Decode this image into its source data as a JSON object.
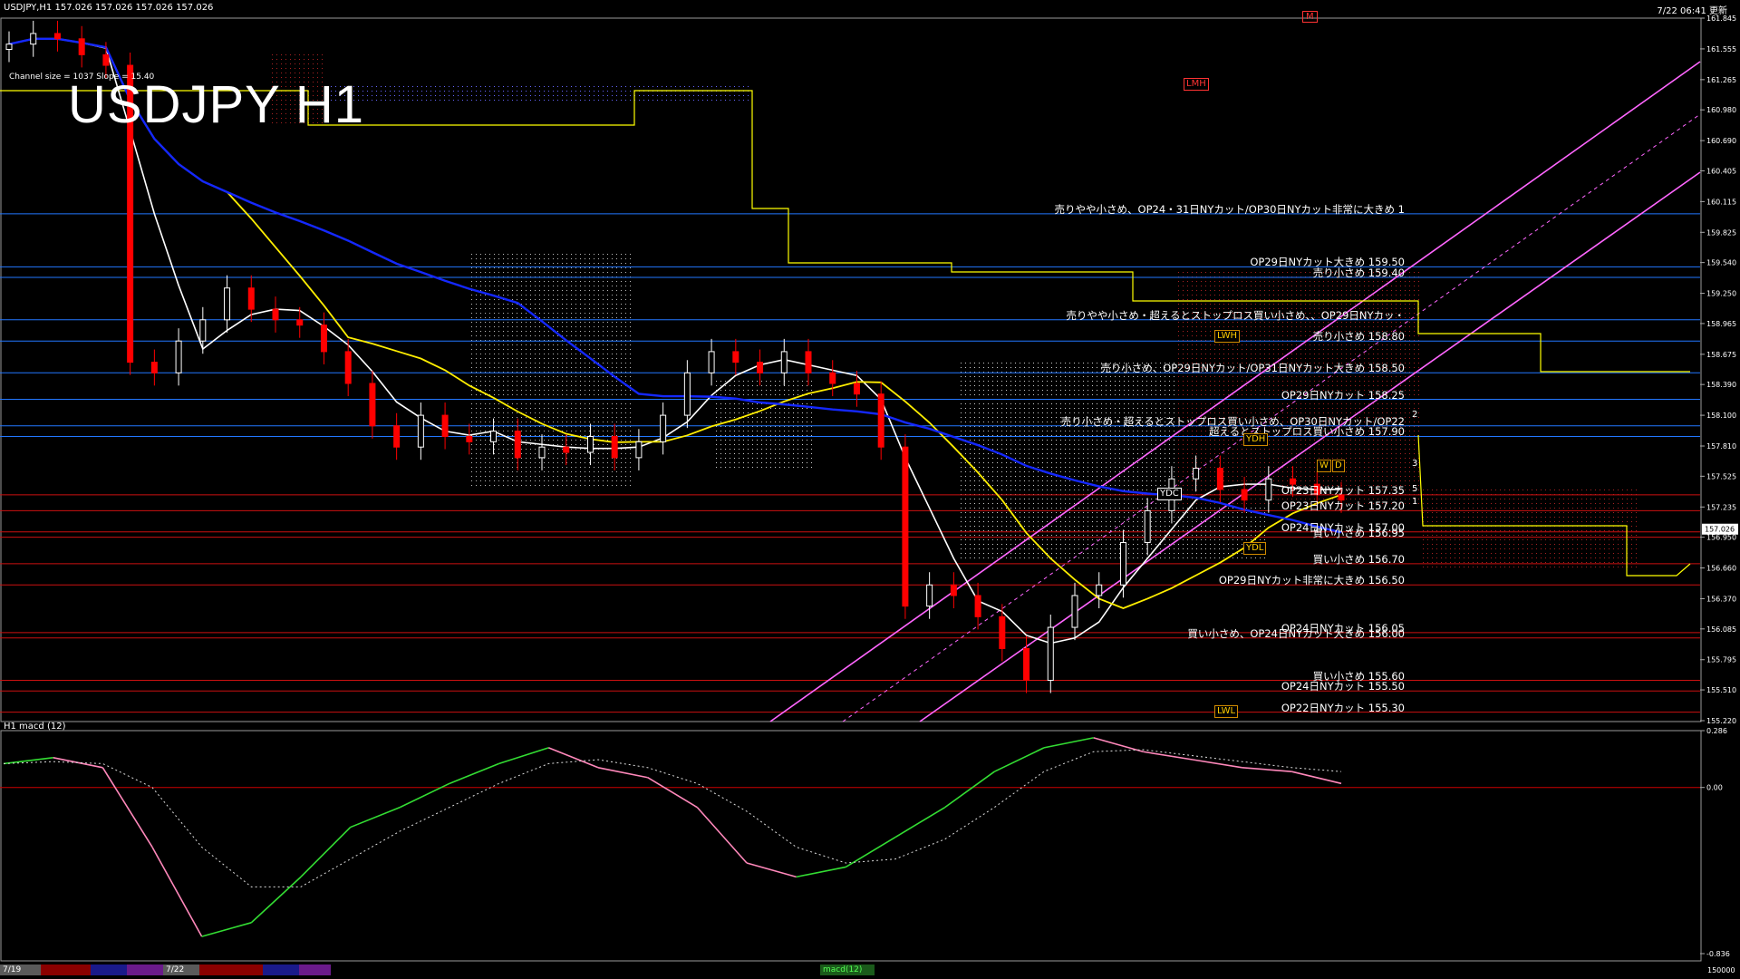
{
  "header": {
    "symbol_info": "USDJPY,H1  157.026 157.026 157.026 157.026",
    "datetime": "7/22 06:41 更新",
    "title": "USDJPY H1",
    "channel_info": "Channel size = 1037 Slope = 15.40",
    "m_marker": "M"
  },
  "colors": {
    "background": "#000000",
    "up_candle": "#ffffff",
    "down_candle": "#ff0000",
    "ma_white": "#ffffff",
    "ma_yellow": "#ffee00",
    "ma_blue": "#1428ff",
    "ichimoku_span": "#ffff00",
    "channel": "#ff66ff",
    "level_blue": "#2277ff",
    "level_red": "#cc1111",
    "macd_main_up": "#33dd33",
    "macd_main_down": "#ff88bb"
  },
  "chart_data": [
    {
      "type": "candlestick",
      "title": "USDJPY H1",
      "ylim": [
        155.22,
        161.845
      ],
      "y_ticks": [
        "161.845",
        "161.555",
        "161.265",
        "160.980",
        "160.690",
        "160.405",
        "160.115",
        "159.825",
        "159.540",
        "159.250",
        "158.965",
        "158.675",
        "158.390",
        "158.100",
        "157.810",
        "157.525",
        "157.235",
        "156.950",
        "156.660",
        "156.370",
        "156.085",
        "155.795",
        "155.510",
        "155.220"
      ],
      "current_price": "157.026",
      "close_path": [
        161.6,
        161.7,
        161.65,
        161.5,
        161.4,
        158.6,
        158.5,
        158.8,
        159.0,
        159.3,
        159.1,
        159.0,
        158.95,
        158.7,
        158.4,
        158.0,
        157.8,
        158.1,
        157.9,
        157.85,
        157.95,
        157.7,
        157.8,
        157.75,
        157.9,
        157.7,
        157.85,
        158.1,
        158.5,
        158.7,
        158.6,
        158.5,
        158.7,
        158.5,
        158.4,
        158.3,
        157.8,
        156.3,
        156.5,
        156.4,
        156.2,
        155.9,
        155.6,
        156.1,
        156.4,
        156.5,
        156.9,
        157.2,
        157.5,
        157.6,
        157.4,
        157.3,
        157.5,
        157.45,
        157.35,
        157.3
      ],
      "levels": [
        {
          "price": 160.0,
          "label": "売りやや小さめ、OP24・31日NYカット/OP30日NYカット非常に大きめ 1",
          "color": "#2277ff"
        },
        {
          "price": 159.5,
          "label": "OP29日NYカット大きめ 159.50",
          "color": "#2277ff"
        },
        {
          "price": 159.4,
          "label": "売り小さめ 159.40",
          "color": "#2277ff"
        },
        {
          "price": 159.0,
          "label": "売りやや小さめ・超えるとストップロス買い小さめ、、OP29日NYカッ・",
          "color": "#2277ff"
        },
        {
          "price": 158.8,
          "label": "売り小さめ 158.80",
          "color": "#2277ff"
        },
        {
          "price": 158.5,
          "label": "売り小さめ、OP29日NYカット/OP31日NYカット大きめ 158.50",
          "color": "#2277ff"
        },
        {
          "price": 158.25,
          "label": "OP29日NYカット 158.25",
          "color": "#2277ff"
        },
        {
          "price": 158.0,
          "label": "売り小さめ・超えるとストップロス買い小さめ、OP30日NYカット/OP22",
          "color": "#2277ff"
        },
        {
          "price": 157.9,
          "label": "超えるとストップロス買い小さめ 157.90",
          "color": "#2277ff"
        },
        {
          "price": 157.35,
          "label": "OP23日NYカット 157.35",
          "color": "#cc1111"
        },
        {
          "price": 157.2,
          "label": "OP23日NYカット 157.20",
          "color": "#cc1111"
        },
        {
          "price": 157.0,
          "label": "OP24日NYカット 157.00",
          "color": "#cc1111"
        },
        {
          "price": 156.95,
          "label": "買い小さめ 156.95",
          "color": "#cc1111"
        },
        {
          "price": 156.7,
          "label": "買い小さめ 156.70",
          "color": "#cc1111"
        },
        {
          "price": 156.5,
          "label": "OP29日NYカット非常に大きめ 156.50",
          "color": "#cc1111"
        },
        {
          "price": 156.05,
          "label": "OP24日NYカット 156.05",
          "color": "#cc1111"
        },
        {
          "price": 156.0,
          "label": "買い小さめ、OP24日NYカット大きめ 156.00",
          "color": "#cc1111"
        },
        {
          "price": 155.6,
          "label": "買い小さめ 155.60",
          "color": "#cc1111"
        },
        {
          "price": 155.5,
          "label": "OP24日NYカット 155.50",
          "color": "#cc1111"
        },
        {
          "price": 155.3,
          "label": "OP22日NYカット 155.30",
          "color": "#cc1111"
        }
      ],
      "tags": [
        "LMH",
        "LWH",
        "YDH",
        "YDC",
        "YDL",
        "LWL",
        "W",
        "D"
      ],
      "wave_labels": [
        "1",
        "2",
        "3",
        "5"
      ]
    },
    {
      "type": "line",
      "title": "H1 macd (12)",
      "ylim": [
        -0.836,
        0.286
      ],
      "y_ticks": [
        "0.286",
        "0.00",
        "-0.836"
      ],
      "series": [
        {
          "values": [
            0.12,
            0.15,
            0.1,
            -0.3,
            -0.75,
            -0.68,
            -0.45,
            -0.2,
            -0.1,
            0.02,
            0.12,
            0.2,
            0.1,
            0.05,
            -0.1,
            -0.38,
            -0.45,
            -0.4,
            -0.25,
            -0.1,
            0.08,
            0.2,
            0.25,
            0.18,
            0.14,
            0.1,
            0.08,
            0.02
          ]
        },
        {
          "values": [
            0.12,
            0.13,
            0.12,
            0.0,
            -0.3,
            -0.5,
            -0.5,
            -0.36,
            -0.22,
            -0.1,
            0.02,
            0.12,
            0.14,
            0.1,
            0.02,
            -0.12,
            -0.3,
            -0.38,
            -0.36,
            -0.26,
            -0.1,
            0.08,
            0.18,
            0.19,
            0.16,
            0.13,
            0.1,
            0.08
          ]
        }
      ]
    }
  ],
  "bottom_tabs": {
    "date1": "7/19",
    "date2": "7/22",
    "indicator": "macd(12)",
    "right_value": "150000"
  }
}
